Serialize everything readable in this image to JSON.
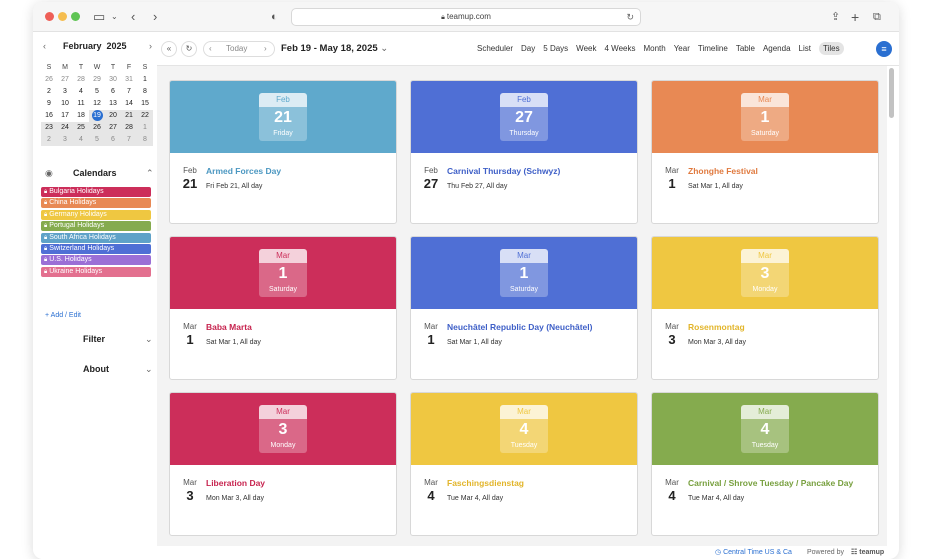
{
  "browser": {
    "url": "teamup.com"
  },
  "mini_calendar": {
    "month": "February",
    "year": "2025",
    "weekdays": [
      "S",
      "M",
      "T",
      "W",
      "T",
      "F",
      "S"
    ],
    "weeks": [
      [
        "26",
        "27",
        "28",
        "29",
        "30",
        "31",
        "1"
      ],
      [
        "2",
        "3",
        "4",
        "5",
        "6",
        "7",
        "8"
      ],
      [
        "9",
        "10",
        "11",
        "12",
        "13",
        "14",
        "15"
      ],
      [
        "16",
        "17",
        "18",
        "19",
        "20",
        "21",
        "22"
      ],
      [
        "23",
        "24",
        "25",
        "26",
        "27",
        "28",
        "1"
      ],
      [
        "2",
        "3",
        "4",
        "5",
        "6",
        "7",
        "8"
      ]
    ]
  },
  "calendars": {
    "label": "Calendars",
    "items": [
      {
        "label": "Bulgaria Holidays",
        "color": "#cc2e5a"
      },
      {
        "label": "China Holidays",
        "color": "#e88954"
      },
      {
        "label": "Germany Holidays",
        "color": "#efc741"
      },
      {
        "label": "Portugal Holidays",
        "color": "#85ab4e"
      },
      {
        "label": "South Africa Holidays",
        "color": "#5fa2c8"
      },
      {
        "label": "Switzerland Holidays",
        "color": "#4f6fd5"
      },
      {
        "label": "U.S. Holidays",
        "color": "#9b6fd6"
      },
      {
        "label": "Ukraine Holidays",
        "color": "#e3708f"
      }
    ],
    "add_edit": "+ Add / Edit"
  },
  "sidebar_sections": {
    "filter": "Filter",
    "about": "About"
  },
  "toolbar": {
    "today": "Today",
    "range_title": "Feb 19 - May 18, 2025",
    "views": [
      "Scheduler",
      "Day",
      "5 Days",
      "Week",
      "4 Weeks",
      "Month",
      "Year",
      "Timeline",
      "Table",
      "Agenda",
      "List",
      "Tiles"
    ],
    "active_view": "Tiles"
  },
  "tiles": [
    {
      "month": "Feb",
      "day": "21",
      "weekday": "Friday",
      "title": "Armed Forces Day",
      "sub": "Fri Feb 21, All day",
      "color": "#5fa9cc",
      "title_color": "#4b97c1"
    },
    {
      "month": "Feb",
      "day": "27",
      "weekday": "Thursday",
      "title": "Carnival Thursday (Schwyz)",
      "sub": "Thu Feb 27, All day",
      "color": "#4f6fd5",
      "title_color": "#3e5fc7"
    },
    {
      "month": "Mar",
      "day": "1",
      "weekday": "Saturday",
      "title": "Zhonghe Festival",
      "sub": "Sat Mar 1, All day",
      "color": "#e88954",
      "title_color": "#e07a3f"
    },
    {
      "month": "Mar",
      "day": "1",
      "weekday": "Saturday",
      "title": "Baba Marta",
      "sub": "Sat Mar 1, All day",
      "color": "#cc2e5a",
      "title_color": "#c7244f"
    },
    {
      "month": "Mar",
      "day": "1",
      "weekday": "Saturday",
      "title": "Neuchâtel Republic Day (Neuchâtel)",
      "sub": "Sat Mar 1, All day",
      "color": "#4f6fd5",
      "title_color": "#3e5fc7"
    },
    {
      "month": "Mar",
      "day": "3",
      "weekday": "Monday",
      "title": "Rosenmontag",
      "sub": "Mon Mar 3, All day",
      "color": "#efc741",
      "title_color": "#e2b52a"
    },
    {
      "month": "Mar",
      "day": "3",
      "weekday": "Monday",
      "title": "Liberation Day",
      "sub": "Mon Mar 3, All day",
      "color": "#cc2e5a",
      "title_color": "#c7244f"
    },
    {
      "month": "Mar",
      "day": "4",
      "weekday": "Tuesday",
      "title": "Faschingsdienstag",
      "sub": "Tue Mar 4, All day",
      "color": "#efc741",
      "title_color": "#e2b52a"
    },
    {
      "month": "Mar",
      "day": "4",
      "weekday": "Tuesday",
      "title": "Carnival / Shrove Tuesday / Pancake Day",
      "sub": "Tue Mar 4, All day",
      "color": "#85ab4e",
      "title_color": "#78a03f"
    }
  ],
  "footer": {
    "timezone": "Central Time US & Ca",
    "powered_by": "Powered by",
    "brand": "teamup"
  }
}
